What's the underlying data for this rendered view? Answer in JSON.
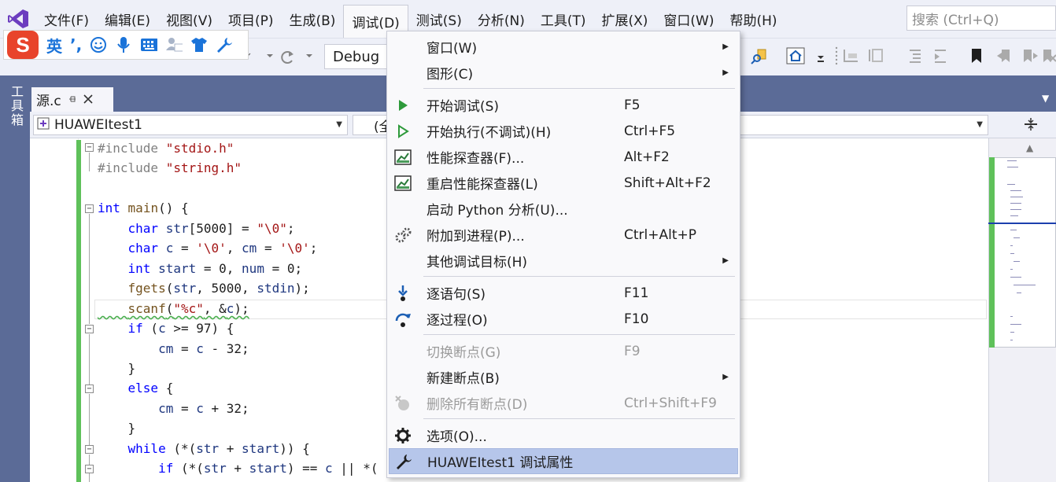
{
  "menubar": {
    "items": [
      "文件(F)",
      "编辑(E)",
      "视图(V)",
      "项目(P)",
      "生成(B)",
      "调试(D)",
      "测试(S)",
      "分析(N)",
      "工具(T)",
      "扩展(X)",
      "窗口(W)",
      "帮助(H)"
    ],
    "open_item": "调试(D)",
    "search_placeholder": "搜索 (Ctrl+Q)"
  },
  "ime": {
    "logo": "S",
    "mode": "英",
    "punct": "’,"
  },
  "toolbar": {
    "configuration": "Debug"
  },
  "toolbox": {
    "label": "工具箱"
  },
  "document": {
    "tab_title": "源.c",
    "project": "HUAWEItest1",
    "scope_prefix": "(全"
  },
  "code": {
    "lines": [
      {
        "parts": [
          [
            "pp",
            "#include "
          ],
          [
            "str",
            "\"stdio.h\""
          ]
        ]
      },
      {
        "parts": [
          [
            "pp",
            "#include "
          ],
          [
            "str",
            "\"string.h\""
          ]
        ]
      },
      {
        "parts": []
      },
      {
        "parts": [
          [
            "kw",
            "int"
          ],
          [
            "",
            " "
          ],
          [
            "fn",
            "main"
          ],
          [
            "",
            "() {"
          ]
        ]
      },
      {
        "parts": [
          [
            "",
            "    "
          ],
          [
            "kw",
            "char"
          ],
          [
            "",
            " "
          ],
          [
            "ident",
            "str"
          ],
          [
            "",
            "[5000] = "
          ],
          [
            "str",
            "\"\\0\""
          ],
          [
            "",
            ";"
          ]
        ]
      },
      {
        "parts": [
          [
            "",
            "    "
          ],
          [
            "kw",
            "char"
          ],
          [
            "",
            " "
          ],
          [
            "ident",
            "c"
          ],
          [
            "",
            " = "
          ],
          [
            "str",
            "'\\0'"
          ],
          [
            "",
            ", "
          ],
          [
            "ident",
            "cm"
          ],
          [
            "",
            " = "
          ],
          [
            "str",
            "'\\0'"
          ],
          [
            "",
            ";"
          ]
        ]
      },
      {
        "parts": [
          [
            "",
            "    "
          ],
          [
            "kw",
            "int"
          ],
          [
            "",
            " "
          ],
          [
            "ident",
            "start"
          ],
          [
            "",
            " = 0, "
          ],
          [
            "ident",
            "num"
          ],
          [
            "",
            " = 0;"
          ]
        ]
      },
      {
        "parts": [
          [
            "",
            "    "
          ],
          [
            "fn",
            "fgets"
          ],
          [
            "",
            "("
          ],
          [
            "ident",
            "str"
          ],
          [
            "",
            ", 5000, "
          ],
          [
            "ident",
            "stdin"
          ],
          [
            "",
            ");"
          ]
        ]
      },
      {
        "parts": [
          [
            "",
            "    "
          ],
          [
            "fn",
            "scanf"
          ],
          [
            "",
            "("
          ],
          [
            "str",
            "\"%c\""
          ],
          [
            "",
            ", &"
          ],
          [
            "ident",
            "c"
          ],
          [
            "",
            ");"
          ]
        ]
      },
      {
        "parts": [
          [
            "",
            "    "
          ],
          [
            "kw",
            "if"
          ],
          [
            "",
            " ("
          ],
          [
            "ident",
            "c"
          ],
          [
            "",
            " >= 97) {"
          ]
        ]
      },
      {
        "parts": [
          [
            "",
            "        "
          ],
          [
            "ident",
            "cm"
          ],
          [
            "",
            " = "
          ],
          [
            "ident",
            "c"
          ],
          [
            "",
            " - 32;"
          ]
        ]
      },
      {
        "parts": [
          [
            "",
            "    }"
          ]
        ]
      },
      {
        "parts": [
          [
            "",
            "    "
          ],
          [
            "kw",
            "else"
          ],
          [
            "",
            " {"
          ]
        ]
      },
      {
        "parts": [
          [
            "",
            "        "
          ],
          [
            "ident",
            "cm"
          ],
          [
            "",
            " = "
          ],
          [
            "ident",
            "c"
          ],
          [
            "",
            " + 32;"
          ]
        ]
      },
      {
        "parts": [
          [
            "",
            "    }"
          ]
        ]
      },
      {
        "parts": [
          [
            "",
            "    "
          ],
          [
            "kw",
            "while"
          ],
          [
            "",
            " (*("
          ],
          [
            "ident",
            "str"
          ],
          [
            "",
            " + "
          ],
          [
            "ident",
            "start"
          ],
          [
            "",
            ")) {"
          ]
        ]
      },
      {
        "parts": [
          [
            "",
            "        "
          ],
          [
            "kw",
            "if"
          ],
          [
            "",
            " (*("
          ],
          [
            "ident",
            "str"
          ],
          [
            "",
            " + "
          ],
          [
            "ident",
            "start"
          ],
          [
            "",
            ") == "
          ],
          [
            "ident",
            "c"
          ],
          [
            "",
            " || *("
          ]
        ]
      }
    ]
  },
  "debug_menu": {
    "items": [
      {
        "label": "窗口(W)",
        "shortcut": "",
        "submenu": true,
        "icon": "",
        "disabled": false
      },
      {
        "label": "图形(C)",
        "shortcut": "",
        "submenu": true,
        "icon": "",
        "disabled": false
      },
      {
        "label": "开始调试(S)",
        "shortcut": "F5",
        "submenu": false,
        "icon": "play-icon",
        "disabled": false
      },
      {
        "label": "开始执行(不调试)(H)",
        "shortcut": "Ctrl+F5",
        "submenu": false,
        "icon": "play-outline-icon",
        "disabled": false
      },
      {
        "label": "性能探查器(F)...",
        "shortcut": "Alt+F2",
        "submenu": false,
        "icon": "performance-chart-icon",
        "disabled": false
      },
      {
        "label": "重启性能探查器(L)",
        "shortcut": "Shift+Alt+F2",
        "submenu": false,
        "icon": "performance-chart-icon",
        "disabled": false
      },
      {
        "label": "启动 Python 分析(U)...",
        "shortcut": "",
        "submenu": false,
        "icon": "",
        "disabled": false
      },
      {
        "label": "附加到进程(P)...",
        "shortcut": "Ctrl+Alt+P",
        "submenu": false,
        "icon": "gears-icon",
        "disabled": false
      },
      {
        "label": "其他调试目标(H)",
        "shortcut": "",
        "submenu": true,
        "icon": "",
        "disabled": false
      },
      {
        "label": "逐语句(S)",
        "shortcut": "F11",
        "submenu": false,
        "icon": "step-into-icon",
        "disabled": false
      },
      {
        "label": "逐过程(O)",
        "shortcut": "F10",
        "submenu": false,
        "icon": "step-over-icon",
        "disabled": false
      },
      {
        "label": "切换断点(G)",
        "shortcut": "F9",
        "submenu": false,
        "icon": "",
        "disabled": true
      },
      {
        "label": "新建断点(B)",
        "shortcut": "",
        "submenu": true,
        "icon": "",
        "disabled": false
      },
      {
        "label": "删除所有断点(D)",
        "shortcut": "Ctrl+Shift+F9",
        "submenu": false,
        "icon": "delete-breakpoints-icon",
        "disabled": true
      },
      {
        "label": "选项(O)...",
        "shortcut": "",
        "submenu": false,
        "icon": "gear-icon",
        "disabled": false
      },
      {
        "label": "HUAWEItest1 调试属性",
        "shortcut": "",
        "submenu": false,
        "icon": "wrench-icon",
        "disabled": false,
        "highlighted": true
      }
    ]
  },
  "colors": {
    "accent": "#5b6b97",
    "menu_highlight": "#b6c6ea",
    "change_bar": "#5fc15a",
    "play_green": "#2e9a3b"
  }
}
